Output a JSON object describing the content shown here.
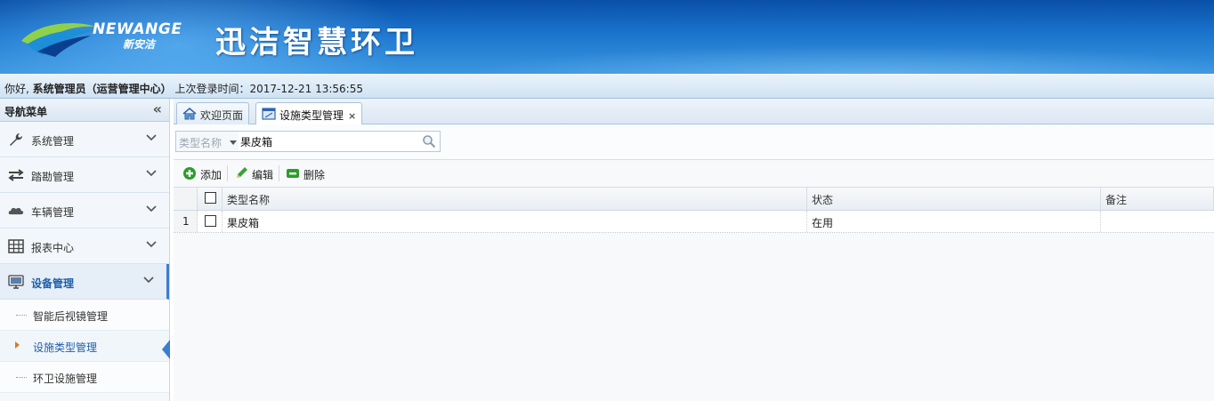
{
  "header": {
    "logo_en": "NEWANGE",
    "logo_cn": "新安洁",
    "app_title": "迅洁智慧环卫"
  },
  "userbar": {
    "greeting": "你好,",
    "user": "系统管理员（运营管理中心）",
    "last_login_label": "上次登录时间：",
    "last_login_time": "2017-12-21 13:56:55"
  },
  "sidebar": {
    "title": "导航菜单",
    "collapse_glyph": "«",
    "items": [
      {
        "label": "系统管理",
        "icon": "wrench-icon"
      },
      {
        "label": "踏勘管理",
        "icon": "transfer-arrows-icon"
      },
      {
        "label": "车辆管理",
        "icon": "cloud-icon"
      },
      {
        "label": "报表中心",
        "icon": "table-icon"
      },
      {
        "label": "设备管理",
        "icon": "monitor-icon"
      }
    ],
    "sub_items": [
      {
        "label": "智能后视镜管理"
      },
      {
        "label": "设施类型管理"
      },
      {
        "label": "环卫设施管理"
      }
    ]
  },
  "tabs": [
    {
      "label": "欢迎页面",
      "icon": "home-icon"
    },
    {
      "label": "设施类型管理",
      "icon": "window-icon",
      "close": "×"
    }
  ],
  "search": {
    "type_label": "类型名称",
    "value": "果皮箱"
  },
  "toolbar": {
    "add": "添加",
    "edit": "编辑",
    "delete": "删除"
  },
  "grid": {
    "columns": [
      "类型名称",
      "状态",
      "备注"
    ],
    "rows": [
      {
        "num": "1",
        "name": "果皮箱",
        "status": "在用",
        "note": ""
      }
    ]
  },
  "colors": {
    "header_blue": "#1a74cc",
    "active_blue": "#1d5fa8",
    "add_green": "#2e9b2e"
  }
}
